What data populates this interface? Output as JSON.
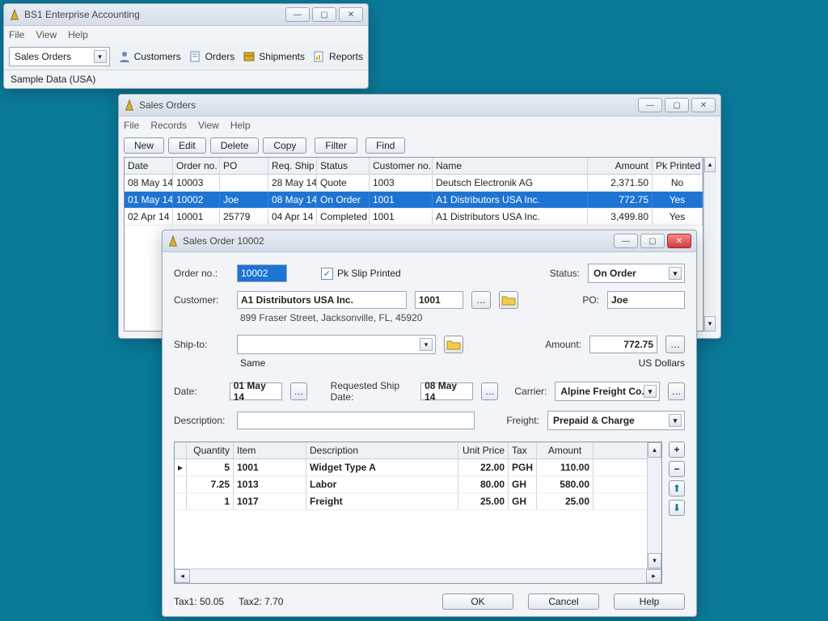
{
  "main": {
    "title": "BS1 Enterprise Accounting",
    "menu": {
      "file": "File",
      "view": "View",
      "help": "Help"
    },
    "nav_select": "Sales Orders",
    "tb": {
      "customers": "Customers",
      "orders": "Orders",
      "shipments": "Shipments",
      "reports": "Reports"
    },
    "status": "Sample Data (USA)"
  },
  "list": {
    "title": "Sales Orders",
    "menu": {
      "file": "File",
      "records": "Records",
      "view": "View",
      "help": "Help"
    },
    "btns": {
      "new": "New",
      "edit": "Edit",
      "delete": "Delete",
      "copy": "Copy",
      "filter": "Filter",
      "find": "Find"
    },
    "cols": {
      "date": "Date",
      "orderno": "Order no.",
      "po": "PO",
      "reqship": "Req. Ship",
      "status": "Status",
      "custno": "Customer no.",
      "name": "Name",
      "amount": "Amount",
      "pk": "Pk Printed"
    },
    "rows": [
      {
        "date": "08 May 14",
        "orderno": "10003",
        "po": "",
        "reqship": "28 May 14",
        "status": "Quote",
        "custno": "1003",
        "name": "Deutsch Electronik AG",
        "amount": "2,371.50",
        "pk": "No"
      },
      {
        "date": "01 May 14",
        "orderno": "10002",
        "po": "Joe",
        "reqship": "08 May 14",
        "status": "On Order",
        "custno": "1001",
        "name": "A1 Distributors USA Inc.",
        "amount": "772.75",
        "pk": "Yes"
      },
      {
        "date": "02 Apr 14",
        "orderno": "10001",
        "po": "25779",
        "reqship": "04 Apr 14",
        "status": "Completed",
        "custno": "1001",
        "name": "A1 Distributors USA Inc.",
        "amount": "3,499.80",
        "pk": "Yes"
      }
    ]
  },
  "order": {
    "title": "Sales Order 10002",
    "lbls": {
      "orderno": "Order no.:",
      "pkslip": "Pk Slip Printed",
      "status": "Status:",
      "customer": "Customer:",
      "po": "PO:",
      "shipto": "Ship-to:",
      "amount": "Amount:",
      "date": "Date:",
      "reqship": "Requested Ship Date:",
      "carrier": "Carrier:",
      "desc": "Description:",
      "freight": "Freight:"
    },
    "vals": {
      "orderno": "10002",
      "status": "On Order",
      "custname": "A1 Distributors USA Inc.",
      "custno": "1001",
      "po": "Joe",
      "addr": "899 Fraser Street, Jacksonville, FL, 45920",
      "shipto": "",
      "shipsame": "Same",
      "amount": "772.75",
      "currency": "US Dollars",
      "date": "01 May 14",
      "reqship": "08 May 14",
      "carrier": "Alpine Freight Co.",
      "freight": "Prepaid & Charge",
      "desc": ""
    },
    "linecols": {
      "qty": "Quantity",
      "item": "Item",
      "desc": "Description",
      "uprice": "Unit Price",
      "tax": "Tax",
      "amount": "Amount"
    },
    "lines": [
      {
        "qty": "5",
        "item": "1001",
        "desc": "Widget Type A",
        "uprice": "22.00",
        "tax": "PGH",
        "amount": "110.00"
      },
      {
        "qty": "7.25",
        "item": "1013",
        "desc": "Labor",
        "uprice": "80.00",
        "tax": "GH",
        "amount": "580.00"
      },
      {
        "qty": "1",
        "item": "1017",
        "desc": "Freight",
        "uprice": "25.00",
        "tax": "GH",
        "amount": "25.00"
      }
    ],
    "tax": {
      "t1": "Tax1: 50.05",
      "t2": "Tax2: 7.70"
    },
    "btns": {
      "ok": "OK",
      "cancel": "Cancel",
      "help": "Help"
    }
  }
}
